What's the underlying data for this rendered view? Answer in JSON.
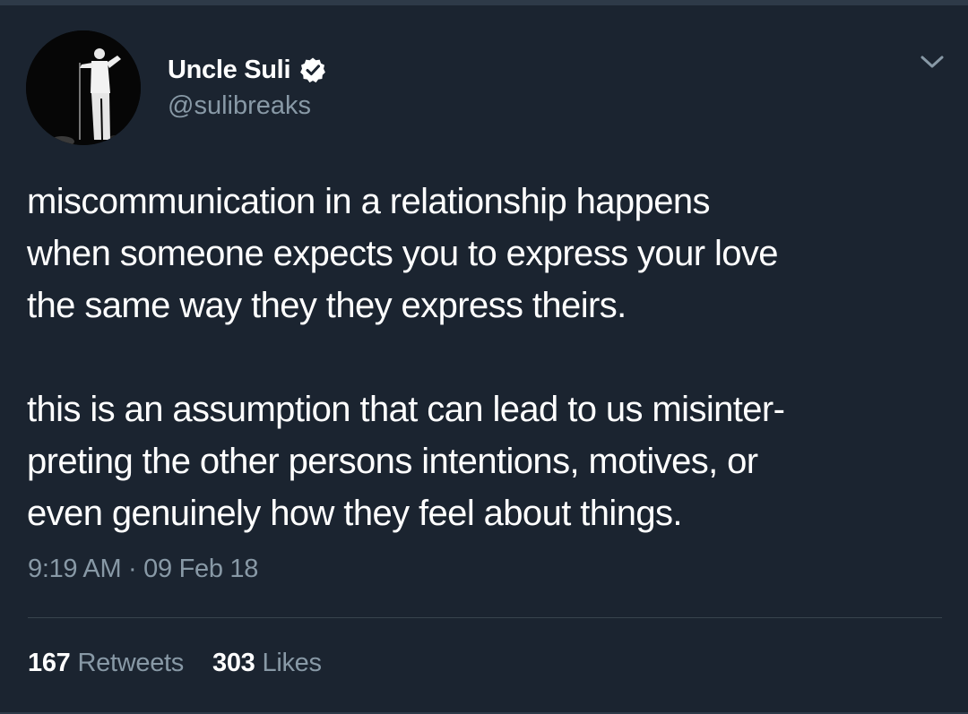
{
  "colors": {
    "background": "#1b2430",
    "text_primary": "#ffffff",
    "text_secondary": "#8899a6",
    "divider": "#38444d"
  },
  "author": {
    "display_name": "Uncle Suli",
    "handle": "@sulibreaks",
    "verified": true,
    "avatar_icon": "performer-on-stage-avatar"
  },
  "tweet": {
    "lines": [
      "miscommunication in a relationship happens",
      "when someone expects you to express your love",
      "the same way they they express theirs.",
      "",
      "this is an assumption that can lead to us misinter-",
      "preting the other persons intentions, motives, or",
      "even genuinely how they feel about things."
    ],
    "timestamp": "9:19 AM · 09 Feb 18"
  },
  "stats": {
    "retweets_count": "167",
    "retweets_label": "Retweets",
    "likes_count": "303",
    "likes_label": "Likes"
  },
  "icons": {
    "verified": "verified-badge-icon",
    "menu": "chevron-down-icon"
  }
}
